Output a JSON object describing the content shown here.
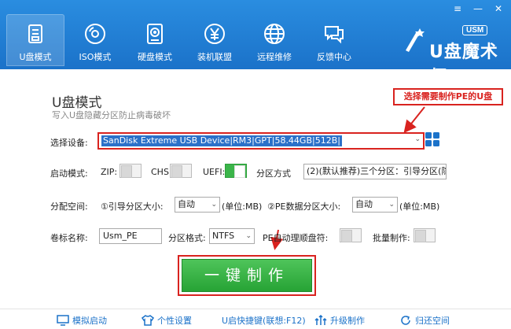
{
  "window_controls": {
    "menu": "≡",
    "minimize": "—",
    "close": "✕"
  },
  "nav": [
    {
      "label": "U盘模式",
      "icon": "usb-drive-icon",
      "active": true
    },
    {
      "label": "ISO模式",
      "icon": "disc-icon"
    },
    {
      "label": "硬盘模式",
      "icon": "hard-disk-icon"
    },
    {
      "label": "装机联盟",
      "icon": "yuan-coin-icon"
    },
    {
      "label": "远程维修",
      "icon": "globe-icon"
    },
    {
      "label": "反馈中心",
      "icon": "chat-bubble-icon"
    }
  ],
  "logo": {
    "badge": "USM",
    "name": "U盘魔术师"
  },
  "page": {
    "title": "U盘模式",
    "subtitle": "写入U盘隐藏分区防止病毒破坏"
  },
  "annotation": "选择需要制作PE的U盘",
  "device": {
    "label": "选择设备:",
    "value": "SanDisk Extreme USB Device|RM3|GPT|58.44GB|512B|"
  },
  "boot_mode": {
    "label": "启动模式:",
    "zip": "ZIP:",
    "chs": "CHS:",
    "uefi": "UEFI:",
    "partition_label": "分区方式",
    "partition_value": "(2)(默认推荐)三个分区：引导分区(隐"
  },
  "space": {
    "label": "分配空间:",
    "boot_size_label": "①引导分区大小:",
    "boot_size_value": "自动",
    "boot_unit": "(单位:MB)",
    "pe_size_label": "②PE数据分区大小:",
    "pe_size_value": "自动",
    "pe_unit": "(单位:MB)"
  },
  "volume": {
    "label": "卷标名称:",
    "value": "Usm_PE",
    "format_label": "分区格式:",
    "format_value": "NTFS",
    "pe_drive_label": "PE自动理顺盘符:",
    "batch_label": "批量制作:"
  },
  "make_button": "一键制作",
  "footer": [
    {
      "label": "模拟启动",
      "icon": "monitor-icon"
    },
    {
      "label": "个性设置",
      "icon": "tshirt-icon"
    },
    {
      "label": "U启快捷键(联想:F12)",
      "icon": "none"
    },
    {
      "label": "升级制作",
      "icon": "upgrade-icon"
    },
    {
      "label": "归还空间",
      "icon": "restore-icon"
    }
  ],
  "colors": {
    "header": "#1b72c9",
    "accent_red": "#d9231f",
    "button_green": "#27a335",
    "link_blue": "#1b72c9"
  }
}
